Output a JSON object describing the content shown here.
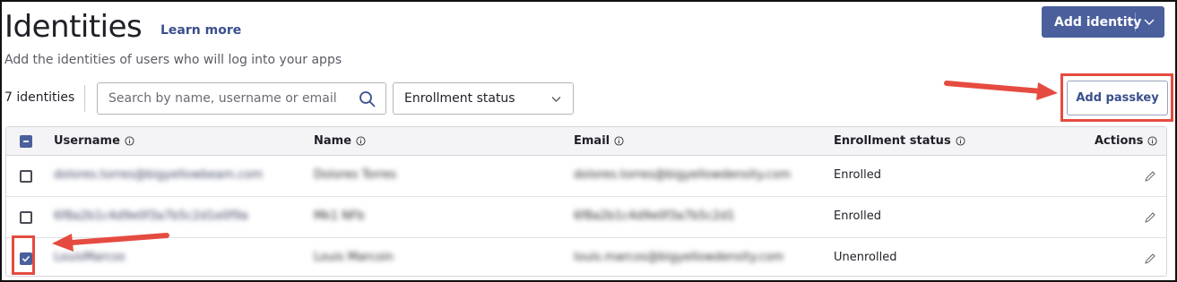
{
  "page": {
    "title": "Identities",
    "learn_more": "Learn more",
    "subtitle": "Add the identities of users who will log into your apps"
  },
  "toolbar": {
    "add_identity_label": "Add identity",
    "identity_count": "7 identities",
    "search_placeholder": "Search by name, username or email",
    "enrollment_filter": "Enrollment status",
    "add_passkey_label": "Add passkey"
  },
  "table": {
    "columns": {
      "username": "Username",
      "name": "Name",
      "email": "Email",
      "enrollment_status": "Enrollment status",
      "actions": "Actions"
    },
    "rows": [
      {
        "username": "dolores.torres@bigyellowbeam.com",
        "name": "Dolores Torres",
        "email": "dolores.torres@bigyellowdensity.com",
        "status": "Enrolled",
        "checked": false
      },
      {
        "username": "6f8a2b1c4d9e0f3a7b5c2d1e0f9a",
        "name": "Mk1 NFb",
        "email": "6f8a2b1c4d9e0f3a7b5c2d1",
        "status": "Enrolled",
        "checked": false
      },
      {
        "username": "LouisMarcos",
        "name": "Louis Marcoin",
        "email": "louis.marcos@bigyellowdensity.com",
        "status": "Unenrolled",
        "checked": true
      }
    ]
  },
  "colors": {
    "primary": "#4a5f9c",
    "annotation": "#e54b40"
  }
}
